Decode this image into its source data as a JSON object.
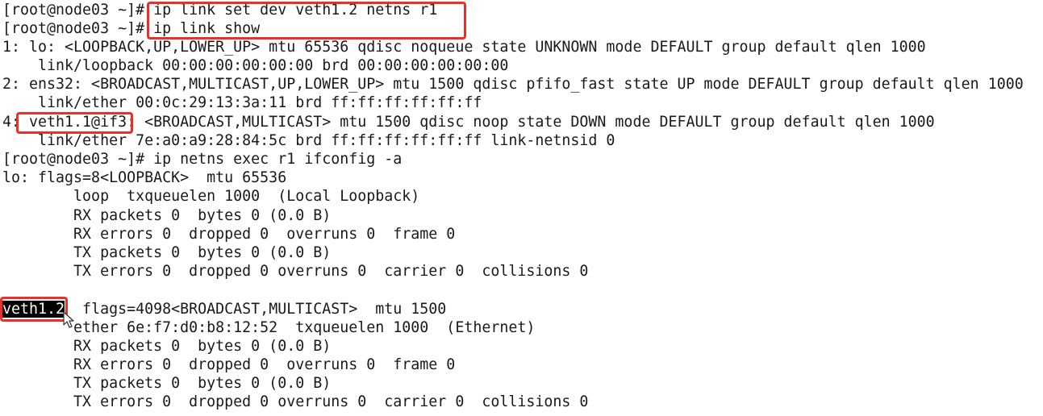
{
  "terminal": {
    "lines": [
      "[root@node03 ~]# ip link set dev veth1.2 netns r1",
      "[root@node03 ~]# ip link show",
      "1: lo: <LOOPBACK,UP,LOWER_UP> mtu 65536 qdisc noqueue state UNKNOWN mode DEFAULT group default qlen 1000",
      "    link/loopback 00:00:00:00:00:00 brd 00:00:00:00:00:00",
      "2: ens32: <BROADCAST,MULTICAST,UP,LOWER_UP> mtu 1500 qdisc pfifo_fast state UP mode DEFAULT group default qlen 1000",
      "    link/ether 00:0c:29:13:3a:11 brd ff:ff:ff:ff:ff:ff",
      "4: veth1.1@if3: <BROADCAST,MULTICAST> mtu 1500 qdisc noop state DOWN mode DEFAULT group default qlen 1000",
      "    link/ether 7e:a0:a9:28:84:5c brd ff:ff:ff:ff:ff:ff link-netnsid 0",
      "[root@node03 ~]# ip netns exec r1 ifconfig -a",
      "lo: flags=8<LOOPBACK>  mtu 65536",
      "        loop  txqueuelen 1000  (Local Loopback)",
      "        RX packets 0  bytes 0 (0.0 B)",
      "        RX errors 0  dropped 0  overruns 0  frame 0",
      "        TX packets 0  bytes 0 (0.0 B)",
      "        TX errors 0  dropped 0 overruns 0  carrier 0  collisions 0",
      "",
      "",
      "        ether 6e:f7:d0:b8:12:52  txqueuelen 1000  (Ethernet)",
      "        RX packets 0  bytes 0 (0.0 B)",
      "        RX errors 0  dropped 0  overruns 0  frame 0",
      "        TX packets 0  bytes 0 (0.0 B)",
      "        TX errors 0  dropped 0 overruns 0  carrier 0  collisions 0"
    ],
    "selected_text": "veth1.2",
    "after_selection": "  flags=4098<BROADCAST,MULTICAST>  mtu 1500",
    "highlight_color": "#e8312a",
    "cursor_icon": "mouse-pointer-icon"
  }
}
